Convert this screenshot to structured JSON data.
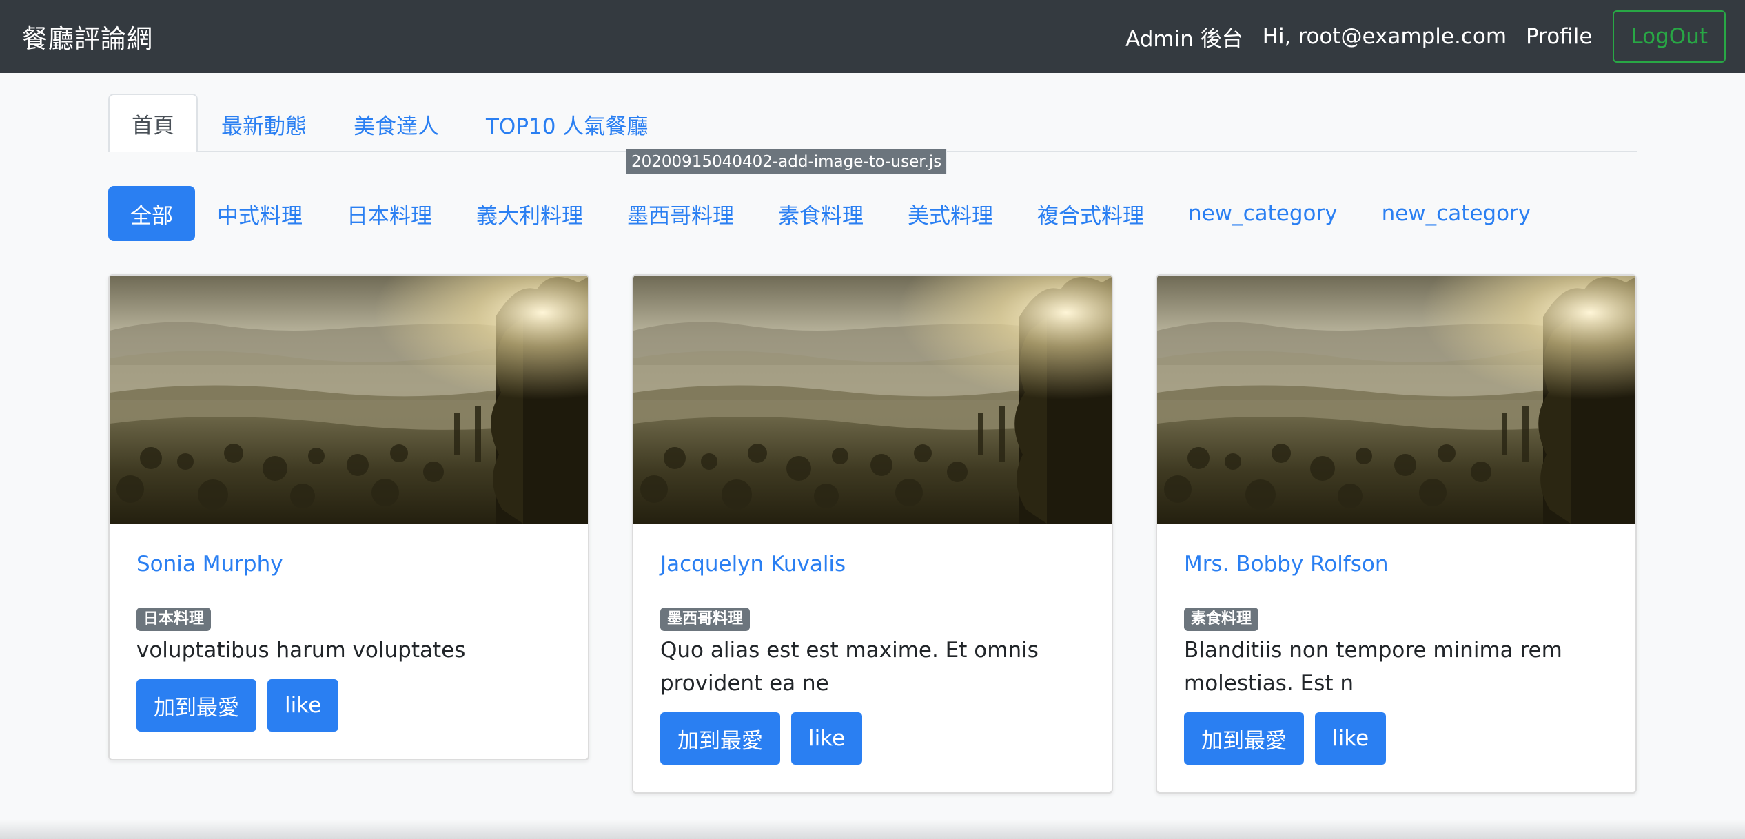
{
  "navbar": {
    "brand": "餐廳評論網",
    "admin_link": "Admin 後台",
    "greeting": "Hi, root@example.com",
    "profile_link": "Profile",
    "logout_label": "LogOut"
  },
  "tabs": [
    {
      "label": "首頁",
      "active": true
    },
    {
      "label": "最新動態",
      "active": false
    },
    {
      "label": "美食達人",
      "active": false
    },
    {
      "label": "TOP10 人氣餐廳",
      "active": false
    }
  ],
  "tooltip": "20200915040402-add-image-to-user.js",
  "categories": [
    {
      "label": "全部",
      "active": true
    },
    {
      "label": "中式料理",
      "active": false
    },
    {
      "label": "日本料理",
      "active": false
    },
    {
      "label": "義大利料理",
      "active": false
    },
    {
      "label": "墨西哥料理",
      "active": false
    },
    {
      "label": "素食料理",
      "active": false
    },
    {
      "label": "美式料理",
      "active": false
    },
    {
      "label": "複合式料理",
      "active": false
    },
    {
      "label": "new_category",
      "active": false
    },
    {
      "label": "new_category",
      "active": false
    }
  ],
  "restaurants": [
    {
      "name": "Sonia Murphy",
      "category": "日本料理",
      "description": "voluptatibus harum voluptates",
      "favorite_label": "加到最愛",
      "like_label": "like"
    },
    {
      "name": "Jacquelyn Kuvalis",
      "category": "墨西哥料理",
      "description": "Quo alias est est maxime. Et omnis provident ea ne",
      "favorite_label": "加到最愛",
      "like_label": "like"
    },
    {
      "name": "Mrs. Bobby Rolfson",
      "category": "素食料理",
      "description": "Blanditiis non tempore minima rem molestias. Est n",
      "favorite_label": "加到最愛",
      "like_label": "like"
    }
  ],
  "colors": {
    "navbar_bg": "#343a40",
    "primary": "#2a7ff2",
    "logout_green": "#28a745",
    "badge_gray": "#6c757d"
  }
}
